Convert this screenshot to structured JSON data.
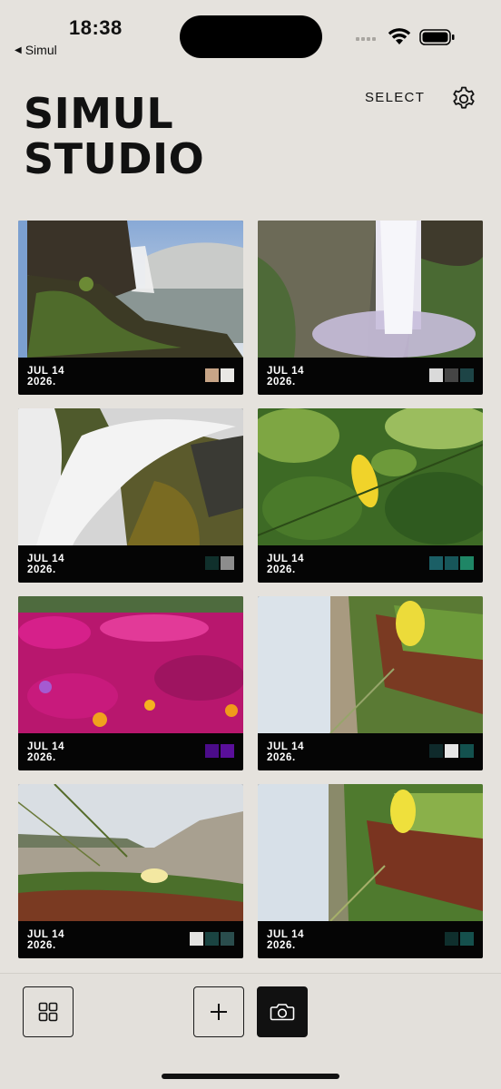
{
  "status": {
    "time": "18:38",
    "back_app": "Simul"
  },
  "header": {
    "title_line1": "SIMUL",
    "title_line2": "STUDIO",
    "select_label": "SELECT",
    "settings_icon": "gear-icon"
  },
  "photos": [
    {
      "date_line1": "JUL 14",
      "date_line2": "2026.",
      "scene": "waterfall-coast",
      "swatches": [
        "#c7a587",
        "#e9e8e5"
      ]
    },
    {
      "date_line1": "JUL 14",
      "date_line2": "2026.",
      "scene": "waterfall-cliff",
      "swatches": [
        "#dadada",
        "#454545",
        "#1d4446"
      ]
    },
    {
      "date_line1": "JUL 14",
      "date_line2": "2026.",
      "scene": "waterfall-moss",
      "swatches": [
        "#10302c",
        "#8d8d8d"
      ]
    },
    {
      "date_line1": "JUL 14",
      "date_line2": "2026.",
      "scene": "lemon-leaves",
      "swatches": [
        "#1b5f66",
        "#17565a",
        "#1f8666"
      ]
    },
    {
      "date_line1": "JUL 14",
      "date_line2": "2026.",
      "scene": "pink-flowers",
      "swatches": [
        "#4b0c8a",
        "#5a0f9a"
      ]
    },
    {
      "date_line1": "JUL 14",
      "date_line2": "2026.",
      "scene": "yellow-flower-side",
      "swatches": [
        "#0f2a2b",
        "#e6e6e6",
        "#13514e"
      ]
    },
    {
      "date_line1": "JUL 14",
      "date_line2": "2026.",
      "scene": "beach-grass",
      "swatches": [
        "#e3e3e1",
        "#1a4442",
        "#2a4d4d"
      ]
    },
    {
      "date_line1": "JUL 14",
      "date_line2": "2026.",
      "scene": "yellow-flower-side-2",
      "swatches": [
        "#0f2f2d",
        "#15504d"
      ]
    }
  ],
  "toolbar": {
    "grid_icon": "grid-icon",
    "add_label": "+",
    "camera_icon": "camera-icon"
  }
}
